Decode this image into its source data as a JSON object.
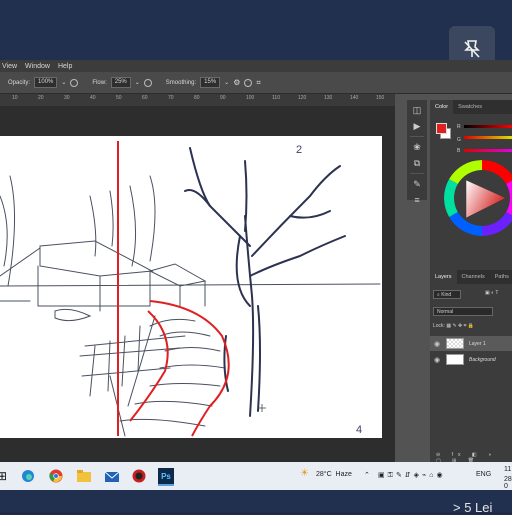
{
  "menu": [
    "View",
    "Window",
    "Help"
  ],
  "options": {
    "opacity_label": "Opacity:",
    "opacity_value": "100%",
    "flow_label": "Flow:",
    "flow_value": "25%",
    "smoothing_label": "Smoothing:",
    "smoothing_value": "15%"
  },
  "ruler_ticks": [
    "10",
    "20",
    "30",
    "40",
    "50",
    "60",
    "70",
    "80",
    "90",
    "100",
    "110",
    "120",
    "130",
    "140",
    "150"
  ],
  "canvas_notes": {
    "top_mark": "2",
    "bottom_mark": "4"
  },
  "color_panel": {
    "tabs": [
      "Color",
      "Swatches"
    ],
    "slider_labels": [
      "R",
      "G",
      "B"
    ],
    "foreground_color": "#e02020",
    "background_color": "#ffffff"
  },
  "layers_panel": {
    "tabs": [
      "Layers",
      "Channels",
      "Paths"
    ],
    "filter_kind": "Kind",
    "blend_mode": "Normal",
    "lock_label": "Lock:",
    "layers": [
      "Layer 1",
      "Background"
    ]
  },
  "taskbar": {
    "weather": "28°C  Haze",
    "language": "ENG",
    "clock_time": "11",
    "clock_date": "28-0"
  },
  "overlay_text": "> 5 Lei",
  "colors": {
    "accent_red": "#e02020",
    "app_bg": "#535353",
    "panel_bg": "#3c3c3c",
    "frame_navy": "#21304f"
  }
}
